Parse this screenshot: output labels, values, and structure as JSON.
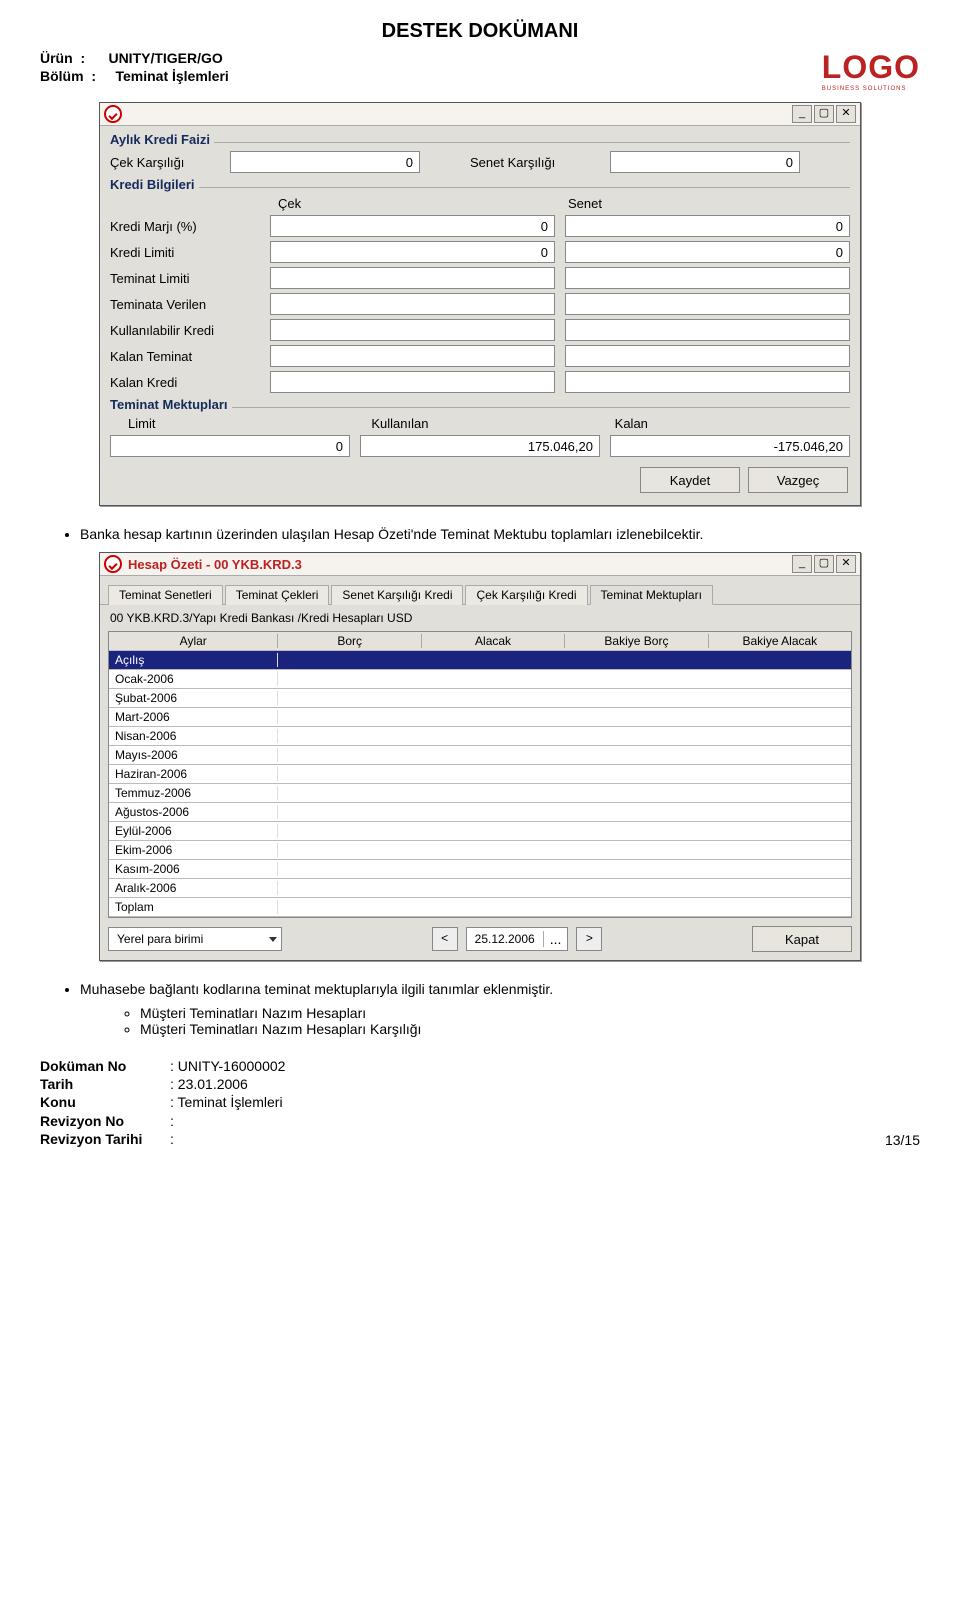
{
  "doc": {
    "title": "DESTEK DOKÜMANI",
    "urun_label": "Ürün",
    "urun_value": "UNITY/TIGER/GO",
    "bolum_label": "Bölüm",
    "bolum_value": "Teminat İşlemleri",
    "logo_text": "LOGO",
    "logo_sub": "BUSINESS SOLUTIONS"
  },
  "win1": {
    "titlebar": "",
    "btn_min": "_",
    "btn_restore": "▢",
    "btn_close": "✕",
    "faiz_title": "Aylık Kredi Faizi",
    "cek_label": "Çek Karşılığı",
    "cek_val": "0",
    "senet_label": "Senet Karşılığı",
    "senet_val": "0",
    "kredi_title": "Kredi Bilgileri",
    "col_cek": "Çek",
    "col_senet": "Senet",
    "rows": [
      {
        "label": "Kredi Marjı (%)",
        "cek": "0",
        "senet": "0"
      },
      {
        "label": "Kredi Limiti",
        "cek": "0",
        "senet": "0"
      },
      {
        "label": "Teminat Limiti",
        "cek": "",
        "senet": ""
      },
      {
        "label": "Teminata Verilen",
        "cek": "",
        "senet": ""
      },
      {
        "label": "Kullanılabilir Kredi",
        "cek": "",
        "senet": ""
      },
      {
        "label": "Kalan Teminat",
        "cek": "",
        "senet": ""
      },
      {
        "label": "Kalan Kredi",
        "cek": "",
        "senet": ""
      }
    ],
    "tm_title": "Teminat Mektupları",
    "tm_limit_label": "Limit",
    "tm_kullanilan_label": "Kullanılan",
    "tm_kalan_label": "Kalan",
    "tm_limit_val": "0",
    "tm_kullanilan_val": "175.046,20",
    "tm_kalan_val": "-175.046,20",
    "btn_save": "Kaydet",
    "btn_cancel": "Vazgeç"
  },
  "bullet1": "Banka hesap kartının üzerinden ulaşılan Hesap Özeti'nde Teminat Mektubu toplamları izlenebilcektir.",
  "win2": {
    "title": "Hesap Özeti - 00   YKB.KRD.3",
    "tabs": [
      "Teminat Senetleri",
      "Teminat Çekleri",
      "Senet Karşılığı Kredi",
      "Çek Karşılığı Kredi",
      "Teminat Mektupları"
    ],
    "path": "00   YKB.KRD.3/Yapı Kredi Bankası /Kredi Hesapları USD",
    "cols": [
      "Aylar",
      "Borç",
      "Alacak",
      "Bakiye Borç",
      "Bakiye Alacak"
    ],
    "months": [
      "Açılış",
      "Ocak-2006",
      "Şubat-2006",
      "Mart-2006",
      "Nisan-2006",
      "Mayıs-2006",
      "Haziran-2006",
      "Temmuz-2006",
      "Ağustos-2006",
      "Eylül-2006",
      "Ekim-2006",
      "Kasım-2006",
      "Aralık-2006",
      "Toplam"
    ],
    "currency": "Yerel para birimi",
    "nav_prev": "<",
    "nav_next": ">",
    "date": "25.12.2006",
    "date_dots": "...",
    "btn_close": "Kapat"
  },
  "bullet2": "Muhasebe bağlantı kodlarına teminat mektuplarıyla ilgili tanımlar eklenmiştir.",
  "sub_bullets": [
    "Müşteri Teminatları Nazım Hesapları",
    "Müşteri Teminatları Nazım Hesapları Karşılığı"
  ],
  "footer": {
    "dokno_label": "Doküman No",
    "dokno_val": ": UNITY-16000002",
    "tarih_label": "Tarih",
    "tarih_val": ": 23.01.2006",
    "konu_label": "Konu",
    "konu_val": ": Teminat İşlemleri",
    "revno_label": "Revizyon No",
    "revno_val": ":",
    "revtarih_label": "Revizyon Tarihi",
    "revtarih_val": ":",
    "page": "13/15"
  }
}
